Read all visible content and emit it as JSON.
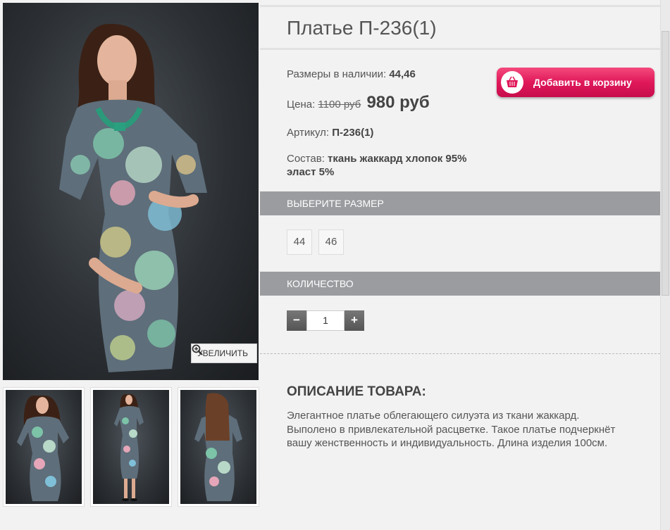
{
  "product": {
    "title": "Платье П-236(1)",
    "sizes_label": "Размеры в наличии:",
    "sizes_value": "44,46",
    "price_label": "Цена:",
    "price_old": "1100 руб",
    "price_new": "980 руб",
    "article_label": "Артикул:",
    "article_value": "П-236(1)",
    "composition_label": "Состав:",
    "composition_value": "ткань жаккард хлопок 95% эласт 5%"
  },
  "cart_button": {
    "label": "Добавить в корзину",
    "icon": "basket-icon"
  },
  "zoom_button": {
    "label": "УВЕЛИЧИТЬ",
    "icon": "zoom-in-icon"
  },
  "size_section": {
    "title": "ВЫБЕРИТЕ РАЗМЕР",
    "options": [
      "44",
      "46"
    ]
  },
  "quantity_section": {
    "title": "КОЛИЧЕСТВО",
    "value": "1",
    "minus": "−",
    "plus": "+"
  },
  "description": {
    "title": "ОПИСАНИЕ ТОВАРА:",
    "text": "Элегантное платье облегающего силуэта из ткани жаккард. Выполено в привлекательной расцветке. Такое платье подчеркнёт вашу женственность и индивидуальность. Длина изделия 100см."
  },
  "colors": {
    "accent": "#e0185a",
    "bar": "#9a9c9f"
  }
}
